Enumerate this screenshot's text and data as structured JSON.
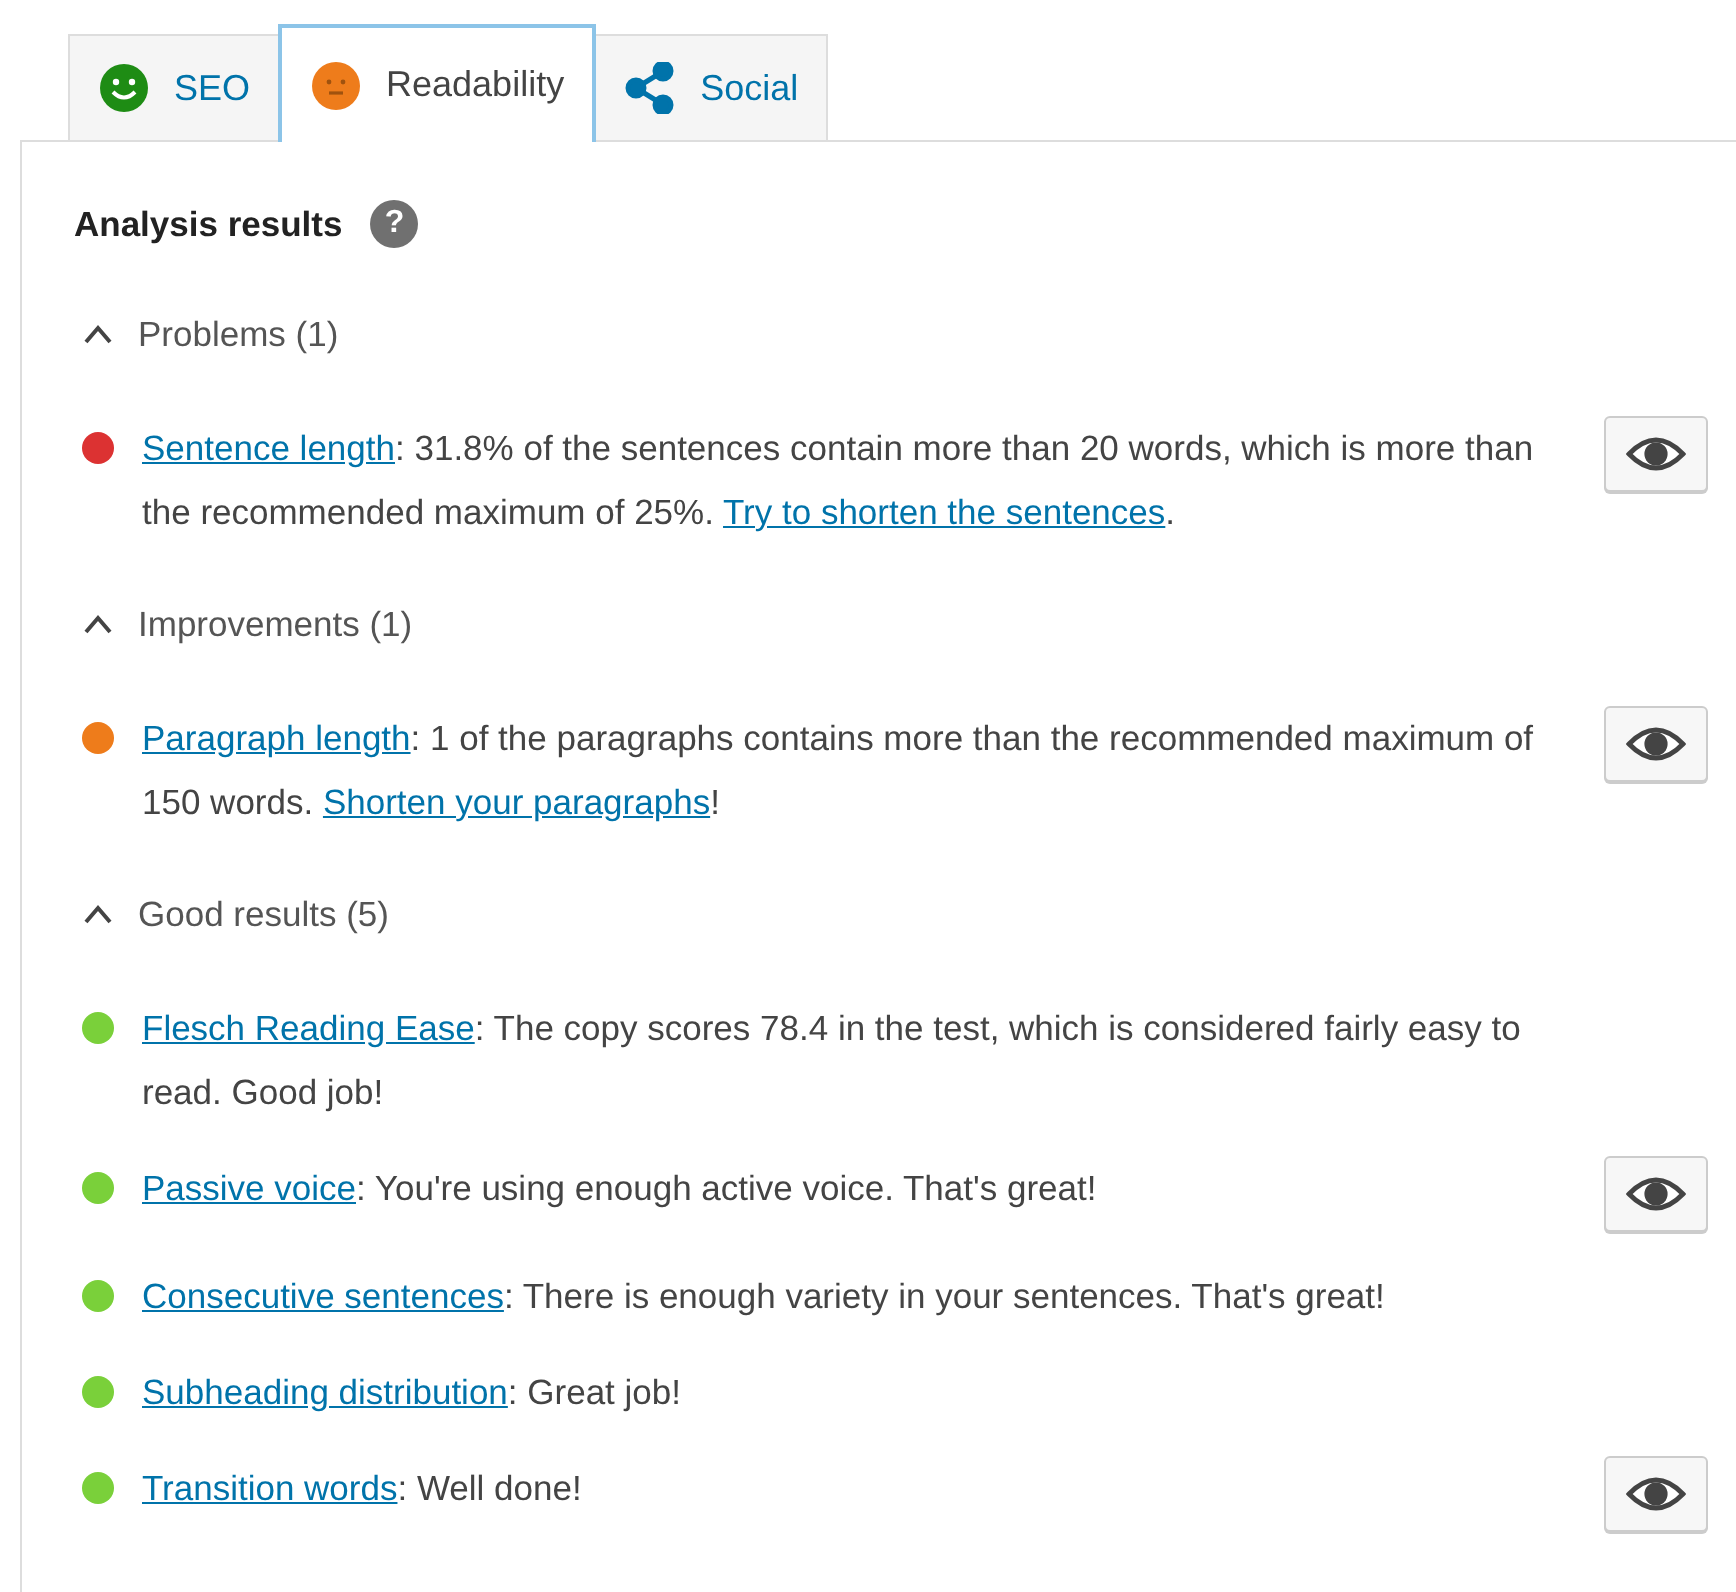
{
  "tabs": [
    {
      "label": "SEO",
      "kind": "smiley",
      "selected": false
    },
    {
      "label": "Readability",
      "kind": "neutral",
      "selected": true
    },
    {
      "label": "Social",
      "kind": "share",
      "selected": false
    }
  ],
  "panel": {
    "title": "Analysis results",
    "help": "?",
    "sections": [
      {
        "label": "Problems (1)",
        "expanded": true,
        "items": [
          {
            "color": "#dc3232",
            "eye_button": true,
            "parts": [
              {
                "text": "Sentence length",
                "link": true
              },
              {
                "text": ": 31.8% of the sentences contain more than 20 words, which is more than the recommended maximum of 25%. ",
                "link": false
              },
              {
                "text": "Try to shorten the sentences",
                "link": true
              },
              {
                "text": ".",
                "link": false
              }
            ]
          }
        ]
      },
      {
        "label": "Improvements (1)",
        "expanded": true,
        "items": [
          {
            "color": "#ee7c1b",
            "eye_button": true,
            "parts": [
              {
                "text": "Paragraph length",
                "link": true
              },
              {
                "text": ": 1 of the paragraphs contains more than the recommended maximum of 150 words. ",
                "link": false
              },
              {
                "text": "Shorten your paragraphs",
                "link": true
              },
              {
                "text": "!",
                "link": false
              }
            ]
          }
        ]
      },
      {
        "label": "Good results (5)",
        "expanded": true,
        "items": [
          {
            "color": "#7ad03a",
            "eye_button": false,
            "parts": [
              {
                "text": "Flesch Reading Ease",
                "link": true
              },
              {
                "text": ": The copy scores 78.4 in the test, which is considered fairly easy to read. Good job!",
                "link": false
              }
            ]
          },
          {
            "color": "#7ad03a",
            "eye_button": true,
            "parts": [
              {
                "text": "Passive voice",
                "link": true
              },
              {
                "text": ": You're using enough active voice. That's great!",
                "link": false
              }
            ]
          },
          {
            "color": "#7ad03a",
            "eye_button": false,
            "parts": [
              {
                "text": "Consecutive sentences",
                "link": true
              },
              {
                "text": ": There is enough variety in your sentences. That's great!",
                "link": false
              }
            ]
          },
          {
            "color": "#7ad03a",
            "eye_button": false,
            "parts": [
              {
                "text": "Subheading distribution",
                "link": true
              },
              {
                "text": ": Great job!",
                "link": false
              }
            ]
          },
          {
            "color": "#7ad03a",
            "eye_button": true,
            "parts": [
              {
                "text": "Transition words",
                "link": true
              },
              {
                "text": ": Well done!",
                "link": false
              }
            ]
          }
        ]
      }
    ]
  }
}
